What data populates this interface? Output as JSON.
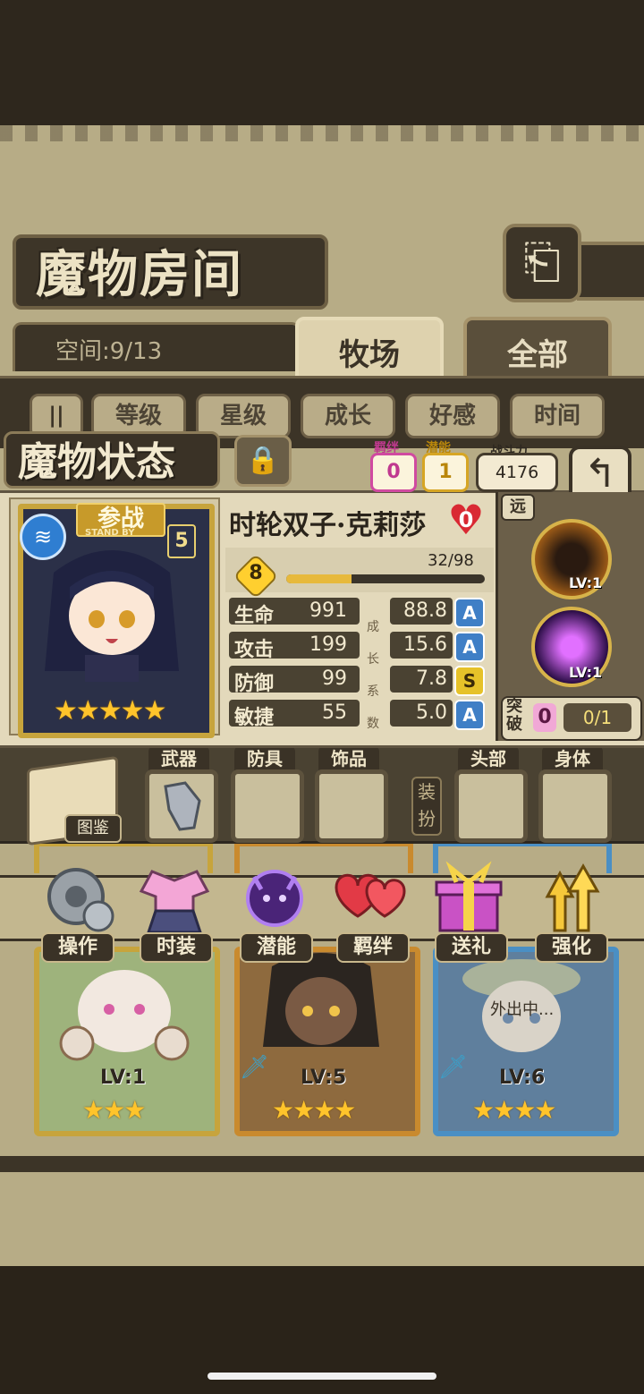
{
  "header": {
    "title": "魔物房间",
    "back_icon": "return-arrow-icon"
  },
  "space": {
    "label": "空间:9/13"
  },
  "tabs": [
    {
      "label": "牧场",
      "active": true
    },
    {
      "label": "全部",
      "active": false
    }
  ],
  "sort_buttons": [
    "等级",
    "星级",
    "成长",
    "好感",
    "时间"
  ],
  "status": {
    "title": "魔物状态",
    "bond_label": "羁绊",
    "bond_value": "0",
    "potential_label": "潜能",
    "potential_value": "1",
    "power_label": "战斗力",
    "power_value": "4176"
  },
  "monster": {
    "standby": "参战",
    "standby_sub": "STAND BY",
    "star_level": "5",
    "stars": "★★★★★",
    "name": "时轮双子·克莉莎",
    "affection": "0",
    "level": "8",
    "exp": "32/98",
    "exp_ratio": 0.33,
    "stats": [
      {
        "label": "生命",
        "value": "991"
      },
      {
        "label": "攻击",
        "value": "199"
      },
      {
        "label": "防御",
        "value": "99"
      },
      {
        "label": "敏捷",
        "value": "55"
      }
    ],
    "growth_chars": [
      "成",
      "长",
      "系",
      "数"
    ],
    "growth": [
      {
        "value": "88.8",
        "grade": "A"
      },
      {
        "value": "15.6",
        "grade": "A"
      },
      {
        "value": "7.8",
        "grade": "S"
      },
      {
        "value": "5.0",
        "grade": "A"
      }
    ],
    "range": "远",
    "skills": [
      {
        "lv": "LV:1",
        "color": "#f08a1c"
      },
      {
        "lv": "LV:1",
        "color": "#9a2fd9"
      }
    ],
    "breakthrough_label": "突破",
    "breakthrough_value": "0",
    "breakthrough_count": "0/1"
  },
  "equipment": {
    "book_label": "图鉴",
    "dress_label": "装扮",
    "slots": [
      "武器",
      "防具",
      "饰品",
      "头部",
      "身体"
    ]
  },
  "actions": [
    "操作",
    "时装",
    "潜能",
    "羁绊",
    "送礼",
    "强化"
  ],
  "monster_cards": [
    {
      "lv": "LV:1",
      "stars": "★★★",
      "border": "#c7a43c"
    },
    {
      "lv": "LV:5",
      "stars": "★★★★",
      "border": "#c98a2e"
    },
    {
      "lv": "LV:6",
      "stars": "★★★★",
      "border": "#4a8fc4",
      "status": "外出中..."
    }
  ]
}
